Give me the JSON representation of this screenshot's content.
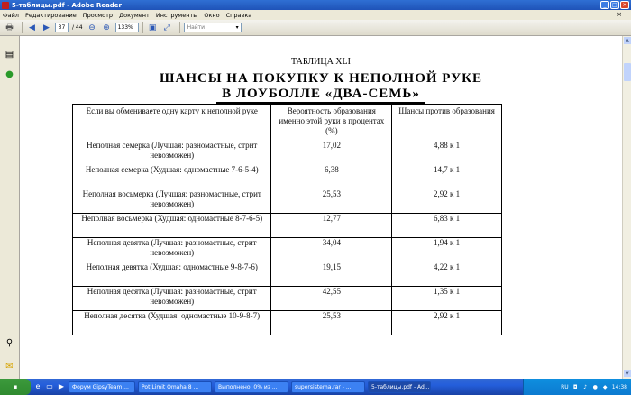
{
  "window": {
    "title": "5-таблицы.pdf - Adobe Reader"
  },
  "menu": [
    "Файл",
    "Редактирование",
    "Просмотр",
    "Документ",
    "Инструменты",
    "Окно",
    "Справка"
  ],
  "toolbar": {
    "page_current": "37",
    "page_total": "/ 44",
    "zoom": "133%",
    "find_placeholder": "Найти"
  },
  "document": {
    "table_label": "ТАБЛИЦА XLI",
    "heading_line1": "ШАНСЫ НА ПОКУПКУ К НЕПОЛНОЙ РУКЕ",
    "heading_line2": "В ЛОУБОЛЛЕ «ДВА-СЕМЬ»",
    "columns": [
      "Если вы обмениваете одну карту к неполной руке",
      "Вероятность образования именно этой руки в процентах (%)",
      "Шансы против образования"
    ],
    "rows": [
      {
        "hand": "Неполная семерка (Лучшая: разномастные, стрит невозможен)",
        "prob": "17,02",
        "odds": "4,88 к 1"
      },
      {
        "hand": "Неполная семерка (Худшая: одномастные 7-6-5-4)",
        "prob": "6,38",
        "odds": "14,7 к 1"
      },
      {
        "hand": "Неполная восьмерка (Лучшая: разномастные, стрит невозможен)",
        "prob": "25,53",
        "odds": "2,92 к 1"
      },
      {
        "hand": "Неполная восьмерка (Худшая: одномастные 8-7-6-5)",
        "prob": "12,77",
        "odds": "6,83 к 1"
      },
      {
        "hand": "Неполная девятка (Лучшая: разномастные, стрит невозможен)",
        "prob": "34,04",
        "odds": "1,94 к 1"
      },
      {
        "hand": "Неполная девятка (Худшая: одномастные 9-8-7-6)",
        "prob": "19,15",
        "odds": "4,22 к 1"
      },
      {
        "hand": "Неполная десятка (Лучшая: разномастные, стрит невозможен)",
        "prob": "42,55",
        "odds": "1,35 к 1"
      },
      {
        "hand": "Неполная десятка (Худшая: одномастные 10-9-8-7)",
        "prob": "25,53",
        "odds": "2,92 к 1"
      }
    ]
  },
  "taskbar": {
    "tasks": [
      "Форум GipsyTeam ...",
      "Pot Limit Omaha 8 ...",
      "Выполнено: 0% из ...",
      "supersistema.rar - ...",
      "5-таблицы.pdf - Ad..."
    ],
    "language": "RU",
    "clock": "14:38"
  }
}
